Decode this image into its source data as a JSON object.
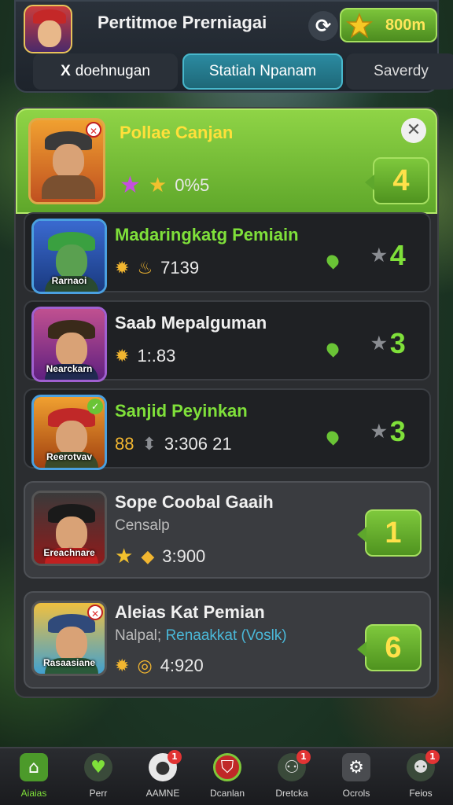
{
  "header": {
    "title": "Pertitmoe Prerniagai",
    "coins": "800m",
    "refresh_icon": "refresh-icon",
    "coin_icon": "crown-coin-icon"
  },
  "tabs": [
    {
      "label": "doehnugan",
      "prefix": "X"
    },
    {
      "label": "Statiah Npanam"
    },
    {
      "label": "Saverdy"
    }
  ],
  "featured": {
    "name": "Pollae Canjan",
    "percent": "0%5",
    "rank": "4"
  },
  "rows": [
    {
      "name": "Madaringkatg Pemiain",
      "tag": "Rarnaoi",
      "stats": "7139",
      "rank": "4"
    },
    {
      "name": "Saab Mepalguman",
      "tag": "Nearckarn",
      "stats": "1:.83",
      "rank": "3"
    },
    {
      "name": "Sanjid Peyinkan",
      "tag": "Reerotvav",
      "stats": "3:306 21",
      "rank": "3",
      "stat_prefix": "88"
    },
    {
      "name": "Sope Coobal Gaaih",
      "sub": "Censalp",
      "tag": "Ereachnare",
      "stats": "3:900",
      "rank": "1"
    },
    {
      "name": "Aleias Kat Pemian",
      "sub_prefix": "Nalpal;",
      "sub_link": "Renaakkat (Voslk)",
      "tag": "Rasaasiane",
      "stats": "4:920",
      "rank": "6"
    }
  ],
  "nav": [
    {
      "label": "Aiaias"
    },
    {
      "label": "Perr"
    },
    {
      "label": "AAMNE",
      "notif": "1"
    },
    {
      "label": "Dcanlan"
    },
    {
      "label": "Dretcka",
      "notif": "1"
    },
    {
      "label": "Ocrols"
    },
    {
      "label": "Feios",
      "notif": "1"
    }
  ],
  "colors": {
    "accent_green": "#7ec83c",
    "tab_active": "#2b8aa0",
    "rank_text": "#ffe14a"
  }
}
